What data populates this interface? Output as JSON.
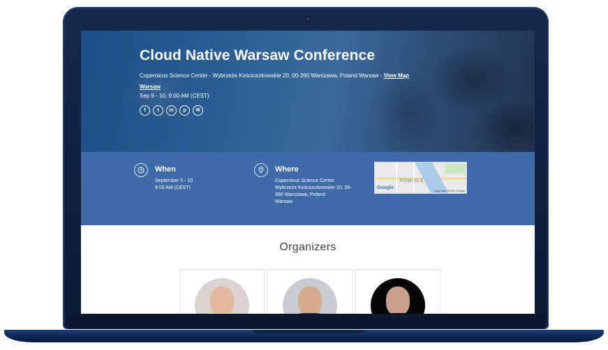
{
  "event": {
    "title": "Cloud Native Warsaw Conference",
    "address": "Copernicus Science Center - Wybrzeże Kościuszkowskie 20, 00-390 Warszawa, Poland Warsaw - ",
    "view_map_label": "View Map",
    "city_link": "Warsaw",
    "date_line": "Sep 9 - 10, 9:00 AM (CEST)"
  },
  "social": [
    {
      "icon": "facebook-icon",
      "glyph": "f"
    },
    {
      "icon": "twitter-icon",
      "glyph": "t"
    },
    {
      "icon": "linkedin-icon",
      "glyph": "in"
    },
    {
      "icon": "pinterest-icon",
      "glyph": "p"
    },
    {
      "icon": "email-icon",
      "glyph": "✉"
    }
  ],
  "when": {
    "heading": "When",
    "line1": "September 9 - 10",
    "line2": "9:00 AM (CEST)"
  },
  "where": {
    "heading": "Where",
    "line1": "Copernicus Science Center",
    "line2": "Wybrzeże Kościuszkowskie 20, 00-",
    "line3": "390 Warszawa, Poland",
    "line4": "Warsaw"
  },
  "map": {
    "district": "POWIŚLE",
    "logo": "Google",
    "attribution": "Map data ©2020 Google"
  },
  "organizers": {
    "heading": "Organizers"
  },
  "colors": {
    "info_band": "#3e6aa9",
    "hero_blue": "#2a5d93"
  }
}
